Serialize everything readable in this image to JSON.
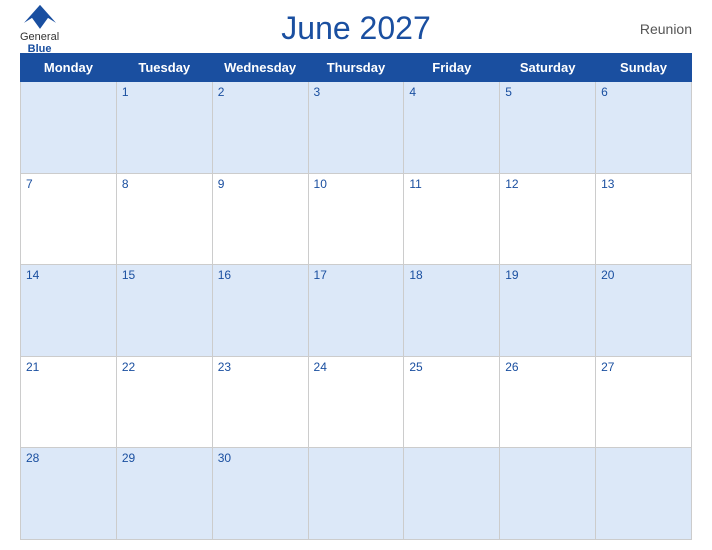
{
  "header": {
    "logo_general": "General",
    "logo_blue": "Blue",
    "title": "June 2027",
    "region": "Reunion"
  },
  "calendar": {
    "days_of_week": [
      "Monday",
      "Tuesday",
      "Wednesday",
      "Thursday",
      "Friday",
      "Saturday",
      "Sunday"
    ],
    "weeks": [
      [
        null,
        1,
        2,
        3,
        4,
        5,
        6
      ],
      [
        7,
        8,
        9,
        10,
        11,
        12,
        13
      ],
      [
        14,
        15,
        16,
        17,
        18,
        19,
        20
      ],
      [
        21,
        22,
        23,
        24,
        25,
        26,
        27
      ],
      [
        28,
        29,
        30,
        null,
        null,
        null,
        null
      ]
    ]
  }
}
